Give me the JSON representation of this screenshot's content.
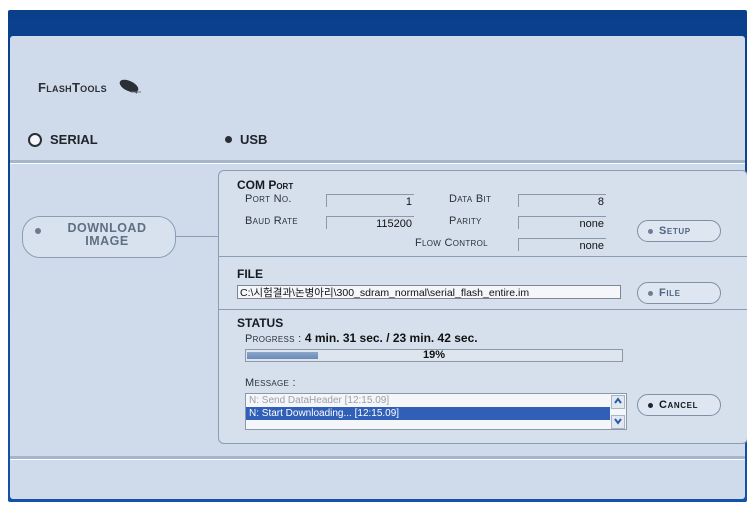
{
  "app": {
    "logo_text": "FlashTools"
  },
  "connection": {
    "serial_label": "SERIAL",
    "usb_label": "USB",
    "selected": "USB"
  },
  "sidebar": {
    "download_button": "DOWNLOAD IMAGE"
  },
  "com_port": {
    "title": "COM Port",
    "port_no_label": "Port No.",
    "port_no_value": "1",
    "data_bit_label": "Data Bit",
    "data_bit_value": "8",
    "baud_rate_label": "Baud Rate",
    "baud_rate_value": "115200",
    "parity_label": "Parity",
    "parity_value": "none",
    "flow_control_label": "Flow Control",
    "flow_control_value": "none",
    "setup_button": "Setup"
  },
  "file": {
    "title": "FILE",
    "path": "C:\\시험결과\\논병아리\\300_sdram_normal\\serial_flash_entire.im",
    "file_button": "File"
  },
  "status": {
    "title": "STATUS",
    "progress_label": "Progress : ",
    "progress_text": "4 min. 31 sec. / 23 min. 42 sec.",
    "progress_percent_text": "19%",
    "progress_fraction": 0.19,
    "message_label": "Message :",
    "messages": [
      "N: Send DataHeader [12:15.09]",
      "N: Start Downloading... [12:15.09]"
    ],
    "selected_message_index": 1,
    "cancel_button": "Cancel"
  },
  "icons": {
    "logo_icon": "satellite-dish-icon",
    "scroll_up": "chevron-up-icon",
    "scroll_down": "chevron-down-icon"
  },
  "colors": {
    "frame_blue": "#0a3f8c",
    "window_bg": "#cfdbea",
    "selected_row": "#2f5fb7"
  }
}
